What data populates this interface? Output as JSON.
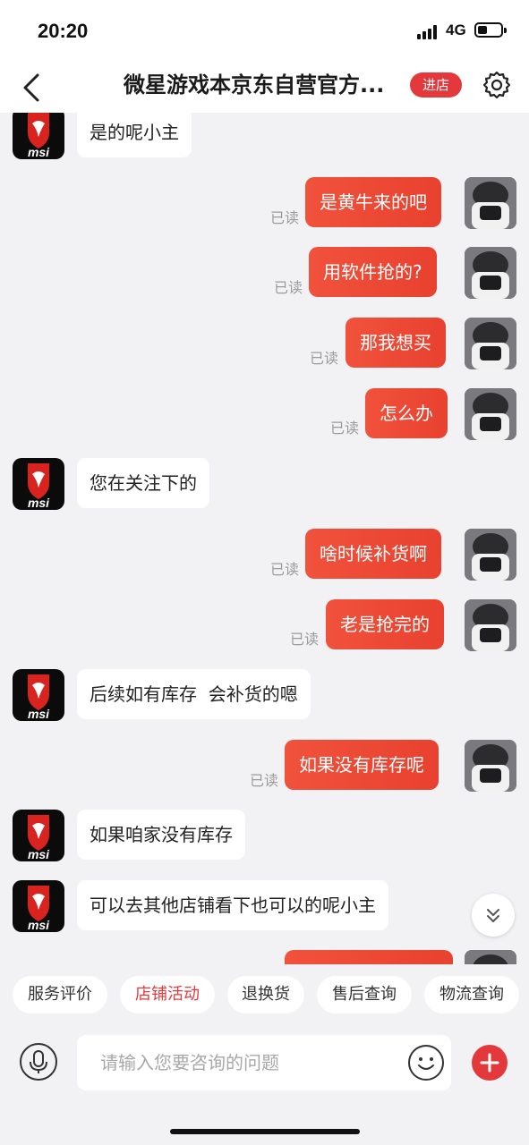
{
  "status_bar": {
    "time": "20:20",
    "network": "4G",
    "icons": [
      "signal-icon",
      "battery-icon"
    ]
  },
  "header": {
    "title": "微星游戏本京东自营官方...",
    "enter_store_label": "进店",
    "icons": [
      "chevron-left-icon",
      "gear-icon"
    ]
  },
  "messages": [
    {
      "from": "shop",
      "text": "是的呢小主"
    },
    {
      "from": "user",
      "text": "是黄牛来的吧",
      "status": "已读"
    },
    {
      "from": "user",
      "text": "用软件抢的?",
      "status": "已读"
    },
    {
      "from": "user",
      "text": "那我想买",
      "status": "已读"
    },
    {
      "from": "user",
      "text": "怎么办",
      "status": "已读"
    },
    {
      "from": "shop",
      "text": "您在关注下的"
    },
    {
      "from": "user",
      "text": "啥时候补货啊",
      "status": "已读"
    },
    {
      "from": "user",
      "text": "老是抢完的",
      "status": "已读"
    },
    {
      "from": "shop",
      "text": "后续如有库存  会补货的嗯"
    },
    {
      "from": "user",
      "text": "如果没有库存呢",
      "status": "已读"
    },
    {
      "from": "shop",
      "text": "如果咱家没有库存"
    },
    {
      "from": "shop",
      "text": "可以去其他店铺看下也可以的呢小主"
    }
  ],
  "shop_logo_text": "msi",
  "quick_actions": [
    "服务评价",
    "店铺活动",
    "退换货",
    "售后查询",
    "物流查询"
  ],
  "active_quick_action": "店铺活动",
  "input": {
    "placeholder": "请输入您要咨询的问题",
    "value": ""
  },
  "colors": {
    "accent": "#e4393c",
    "bubble_out": "#ef4b37",
    "bubble_in": "#ffffff",
    "background": "#f2f2f5"
  }
}
